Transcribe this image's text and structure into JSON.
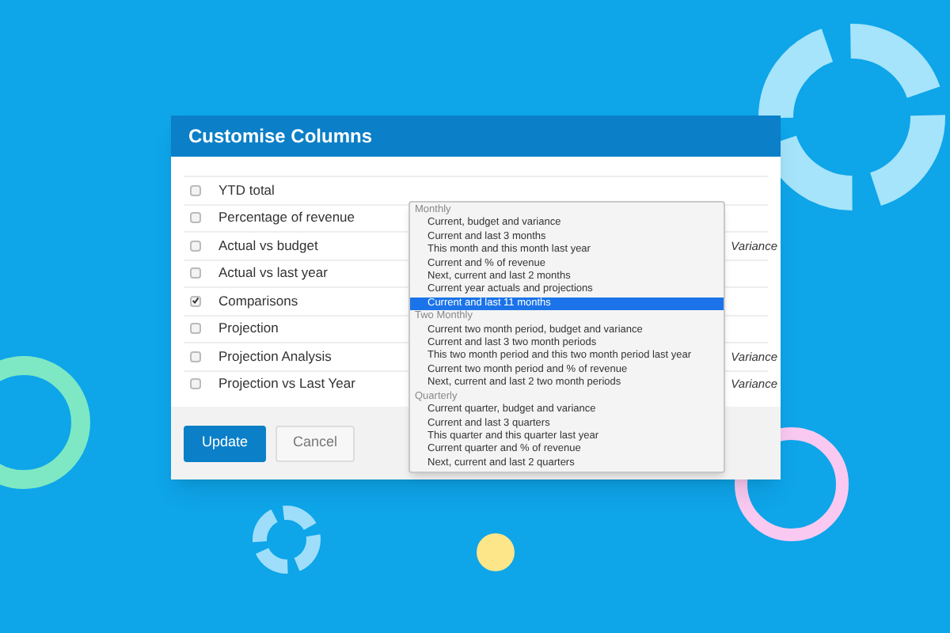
{
  "dialog": {
    "title": "Customise Columns"
  },
  "rows": [
    {
      "label": "YTD total",
      "checked": false
    },
    {
      "label": "Percentage of revenue",
      "checked": false
    },
    {
      "label": "Actual vs budget",
      "checked": false,
      "value": "Variance"
    },
    {
      "label": "Actual vs last year",
      "checked": false
    },
    {
      "label": "Comparisons",
      "checked": true
    },
    {
      "label": "Projection",
      "checked": false
    },
    {
      "label": "Projection Analysis",
      "checked": false,
      "value": "Variance"
    },
    {
      "label": "Projection vs Last Year",
      "checked": false,
      "value": "Variance"
    }
  ],
  "dropdown": {
    "groups": [
      {
        "label": "Monthly",
        "options": [
          {
            "label": "Current, budget and variance",
            "selected": false
          },
          {
            "label": "Current and last 3 months",
            "selected": false
          },
          {
            "label": "This month and this month last year",
            "selected": false
          },
          {
            "label": "Current and % of revenue",
            "selected": false
          },
          {
            "label": "Next, current and last 2 months",
            "selected": false
          },
          {
            "label": "Current year actuals and projections",
            "selected": false
          },
          {
            "label": "Current and last 11 months",
            "selected": true
          }
        ]
      },
      {
        "label": "Two Monthly",
        "options": [
          {
            "label": "Current two month period, budget and variance",
            "selected": false
          },
          {
            "label": "Current and last 3 two month periods",
            "selected": false
          },
          {
            "label": "This two month period and this two month period last year",
            "selected": false
          },
          {
            "label": "Current two month period and % of revenue",
            "selected": false
          },
          {
            "label": "Next, current and last 2 two month periods",
            "selected": false
          }
        ]
      },
      {
        "label": "Quarterly",
        "options": [
          {
            "label": "Current quarter, budget and variance",
            "selected": false
          },
          {
            "label": "Current and last 3 quarters",
            "selected": false
          },
          {
            "label": "This quarter and this quarter last year",
            "selected": false
          },
          {
            "label": "Current quarter and % of revenue",
            "selected": false
          },
          {
            "label": "Next, current and last 2 quarters",
            "selected": false
          }
        ]
      }
    ]
  },
  "buttons": [
    {
      "label": "Update",
      "kind": "primary"
    },
    {
      "label": "Cancel",
      "kind": "secondary"
    }
  ]
}
